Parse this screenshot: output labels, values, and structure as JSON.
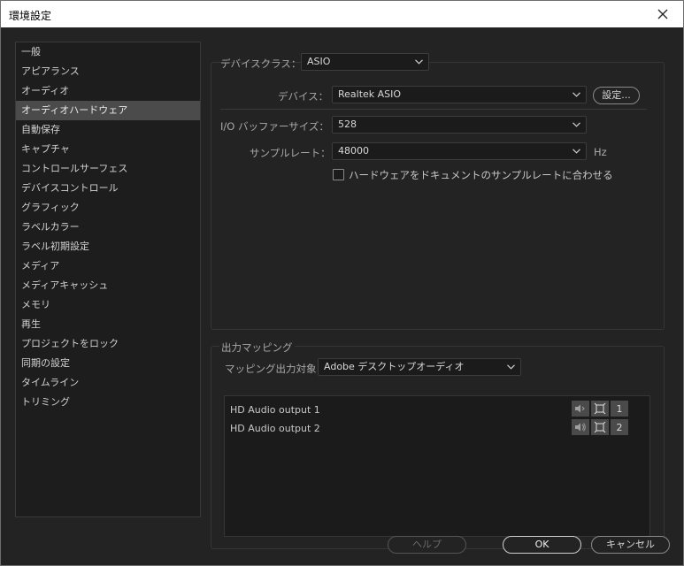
{
  "window": {
    "title": "環境設定"
  },
  "sidebar": {
    "items": [
      {
        "label": "一般"
      },
      {
        "label": "アピアランス"
      },
      {
        "label": "オーディオ"
      },
      {
        "label": "オーディオハードウェア",
        "active": true
      },
      {
        "label": "自動保存"
      },
      {
        "label": "キャプチャ"
      },
      {
        "label": "コントロールサーフェス"
      },
      {
        "label": "デバイスコントロール"
      },
      {
        "label": "グラフィック"
      },
      {
        "label": "ラベルカラー"
      },
      {
        "label": "ラベル初期設定"
      },
      {
        "label": "メディア"
      },
      {
        "label": "メディアキャッシュ"
      },
      {
        "label": "メモリ"
      },
      {
        "label": "再生"
      },
      {
        "label": "プロジェクトをロック"
      },
      {
        "label": "同期の設定"
      },
      {
        "label": "タイムライン"
      },
      {
        "label": "トリミング"
      }
    ]
  },
  "hardware": {
    "device_class_label": "デバイスクラス：",
    "device_class_value": "ASIO",
    "device_label": "デバイス：",
    "device_value": "Realtek ASIO",
    "settings_button": "設定...",
    "buffer_label": "I/O バッファーサイズ：",
    "buffer_value": "528",
    "samplerate_label": "サンプルレート：",
    "samplerate_value": "48000",
    "samplerate_unit": "Hz",
    "match_checkbox_label": "ハードウェアをドキュメントのサンプルレートに合わせる",
    "match_checked": false
  },
  "mapping": {
    "section_title": "出力マッピング",
    "target_label": "マッピング出力対象：",
    "target_value": "Adobe デスクトップオーディオ",
    "outputs": [
      {
        "name": "HD Audio output 1",
        "channel": "1"
      },
      {
        "name": "HD Audio output 2",
        "channel": "2"
      }
    ]
  },
  "footer": {
    "help": "ヘルプ",
    "ok": "OK",
    "cancel": "キャンセル"
  },
  "colors": {
    "background": "#232323",
    "panel": "#1d1d1d",
    "selected": "#4b4b4b",
    "titlebar": "#ffffff"
  }
}
